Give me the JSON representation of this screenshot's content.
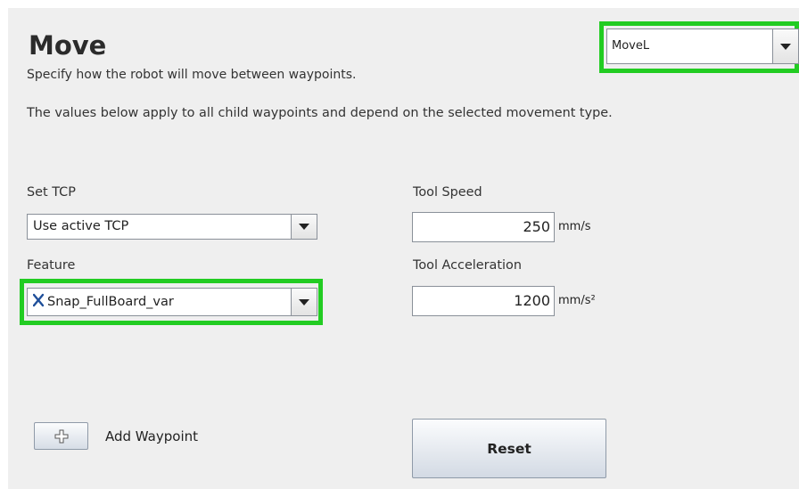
{
  "header": {
    "title": "Move",
    "subtitle": "Specify how the robot will move between waypoints.",
    "description": "The values below apply to all child waypoints and depend on the selected movement type."
  },
  "move_type": {
    "selected": "MoveL",
    "icon": "chevron-down-icon"
  },
  "tcp": {
    "label": "Set TCP",
    "selected": "Use active TCP"
  },
  "feature": {
    "label": "Feature",
    "selected": "Snap_FullBoard_var",
    "icon": "variable-x-icon"
  },
  "tool_speed": {
    "label": "Tool Speed",
    "value": "250",
    "unit": "mm/s"
  },
  "tool_acceleration": {
    "label": "Tool Acceleration",
    "value": "1200",
    "unit": "mm/s²"
  },
  "add_waypoint": {
    "label": "Add Waypoint",
    "icon": "plus-icon"
  },
  "reset": {
    "label": "Reset"
  },
  "colors": {
    "highlight": "#22cc22",
    "panel": "#efefef"
  }
}
